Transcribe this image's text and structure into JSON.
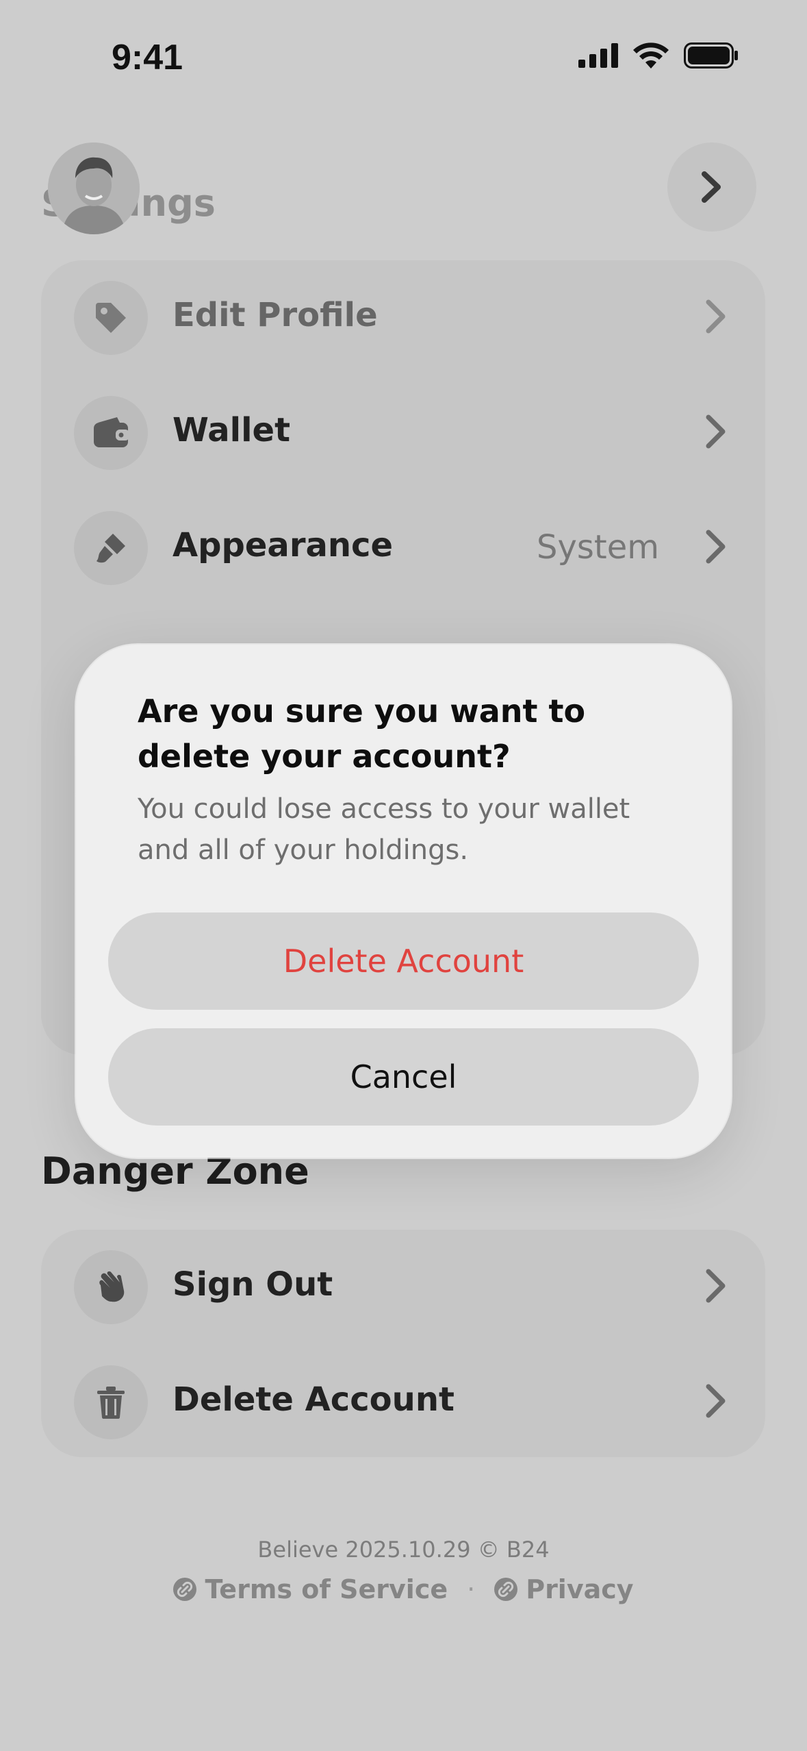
{
  "status_bar": {
    "time": "9:41"
  },
  "header": {
    "title": "Settings"
  },
  "settings_items": [
    {
      "label": "Edit Profile",
      "icon": "tag-icon"
    },
    {
      "label": "Wallet",
      "icon": "wallet-icon"
    },
    {
      "label": "Appearance",
      "value": "System",
      "icon": "paintbrush-icon"
    }
  ],
  "danger_zone": {
    "title": "Danger Zone",
    "items": [
      {
        "label": "Sign Out",
        "icon": "waving-hand-icon"
      },
      {
        "label": "Delete Account",
        "icon": "trash-icon"
      }
    ]
  },
  "footer": {
    "version": "Believe 2025.10.29 © B24",
    "terms": "Terms of Service",
    "separator": "·",
    "privacy": "Privacy"
  },
  "dialog": {
    "title": "Are you sure you want to delete your account?",
    "message": "You could lose access to your wallet and all of your holdings.",
    "confirm_label": "Delete Account",
    "cancel_label": "Cancel"
  },
  "colors": {
    "background": "#cdcdcd",
    "destructive": "#e0433f",
    "dialog_bg": "#efefef"
  }
}
